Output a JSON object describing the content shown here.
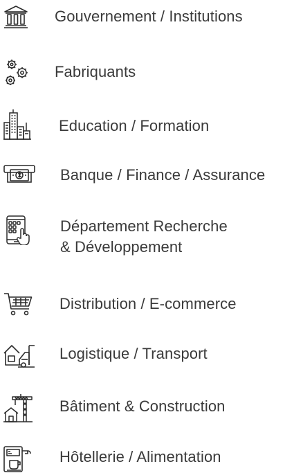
{
  "sectors": {
    "items": [
      {
        "label": "Gouvernement / Institutions",
        "icon": "government-building-icon"
      },
      {
        "label": "Fabriquants",
        "icon": "gears-icon"
      },
      {
        "label": "Education / Formation",
        "icon": "city-buildings-icon"
      },
      {
        "label": "Banque / Finance / Assurance",
        "icon": "atm-banknote-icon"
      },
      {
        "label_line1": "Département Recherche",
        "label_line2": "& Développement",
        "icon": "tablet-touch-icon"
      },
      {
        "label": "Distribution / E-commerce",
        "icon": "shopping-cart-icon"
      },
      {
        "label": "Logistique / Transport",
        "icon": "warehouse-truck-icon"
      },
      {
        "label": "Bâtiment & Construction",
        "icon": "construction-crane-icon"
      },
      {
        "label": "Hôtellerie / Alimentation",
        "icon": "coffee-machine-icon"
      }
    ]
  },
  "colors": {
    "text": "#3a3a3a",
    "icon_stroke": "#2b2b2b",
    "background": "#ffffff"
  }
}
